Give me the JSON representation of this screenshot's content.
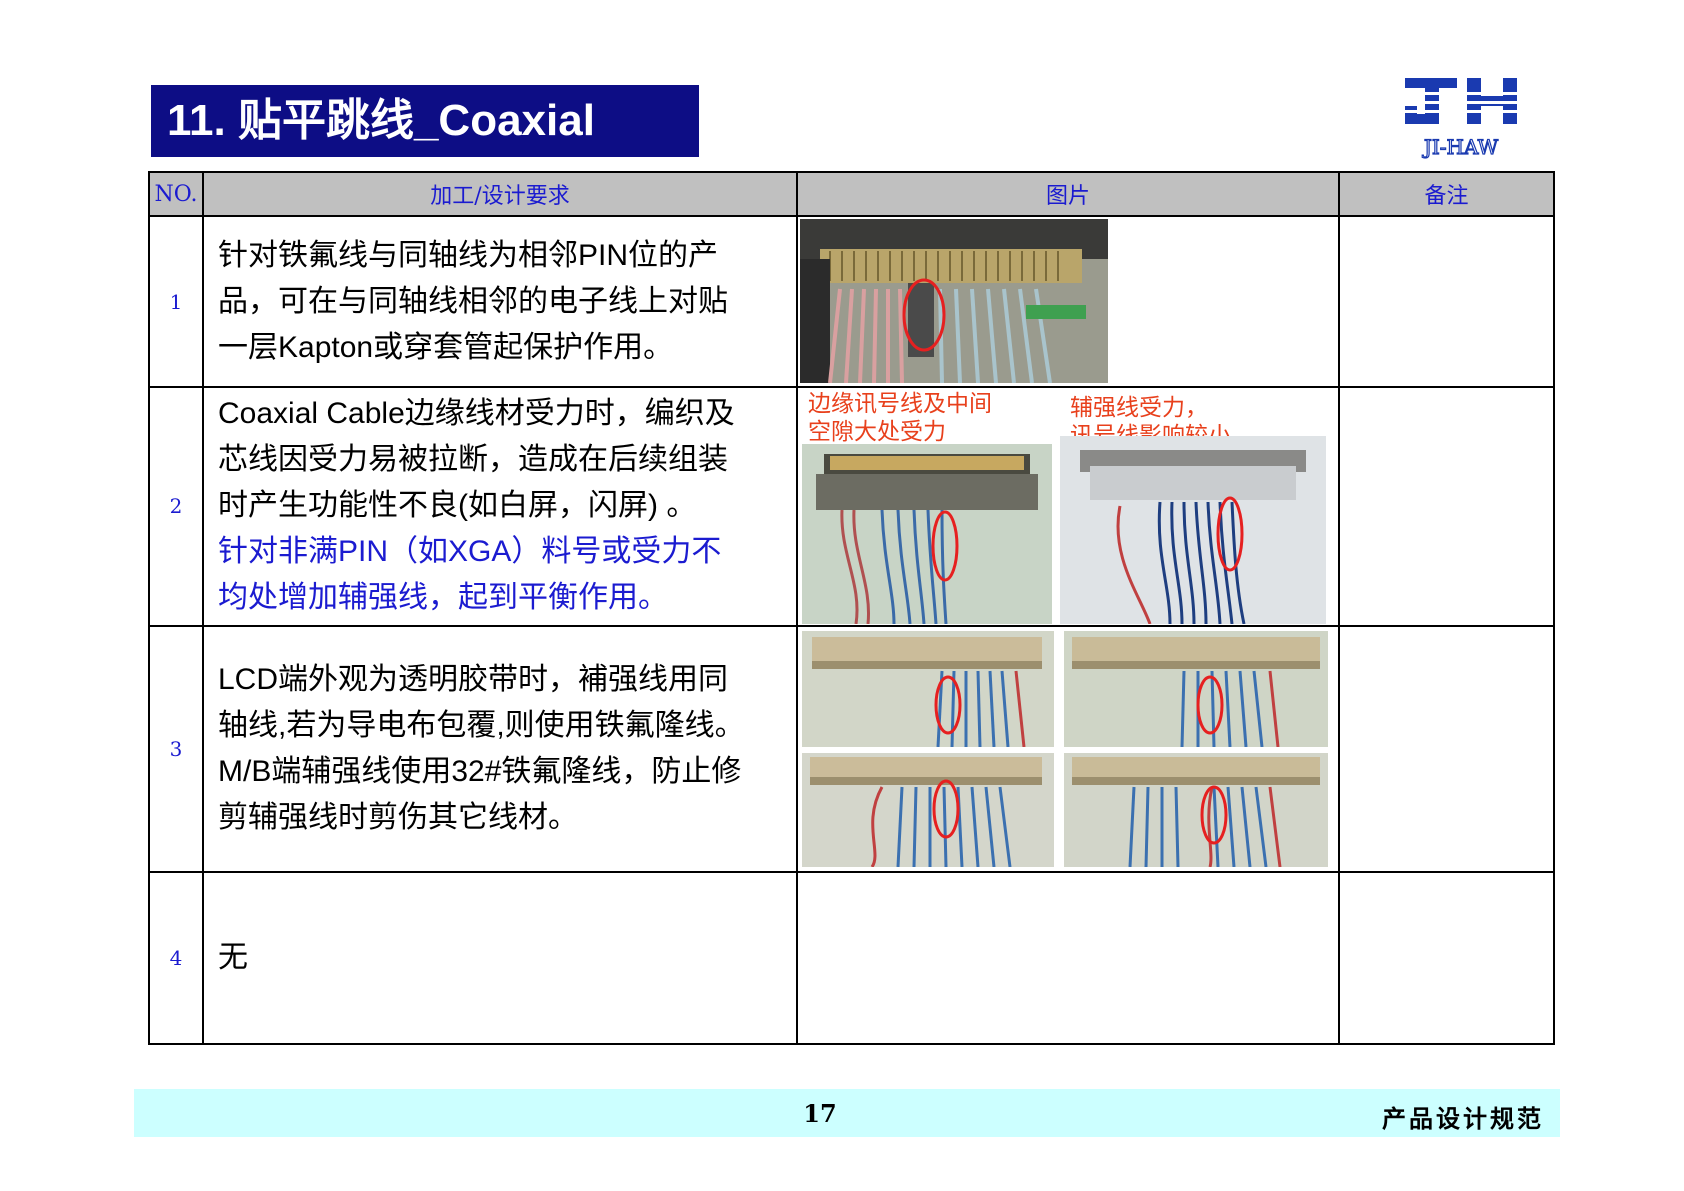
{
  "title": "11.  贴平跳线_Coaxial",
  "logo": {
    "text": "JI-HAW",
    "letters": "JH",
    "color": "#1a3ab0"
  },
  "table": {
    "headers": [
      "NO.",
      "加工/设计要求",
      "图片",
      "备注"
    ],
    "rows": [
      {
        "no": "1",
        "lines": [
          "针对铁氟线与同轴线为相邻PIN位的产",
          "品，可在与同轴线相邻的电子线上对贴",
          "一层Kapton或穿套管起保护作用。"
        ]
      },
      {
        "no": "2",
        "lines": [
          "Coaxial Cable边缘线材受力时，编织及",
          "芯线因受力易被拉断，造成在后续组装",
          "时产生功能性不良(如白屏，闪屏) 。"
        ],
        "blue_lines": [
          "针对非满PIN（如XGA）料号或受力不",
          "均处增加辅强线，起到平衡作用。"
        ],
        "annotations": {
          "left": [
            "边缘讯号线及中间",
            "空隙大处受力"
          ],
          "right": [
            "辅强线受力，",
            "讯号线影响较小"
          ]
        }
      },
      {
        "no": "3",
        "lines": [
          "LCD端外观为透明胶带时，補强线用同",
          "轴线,若为导电布包覆,则使用铁氟隆线。",
          "M/B端辅强线使用32#铁氟隆线，防止修",
          "剪辅强线时剪伤其它线材。"
        ]
      },
      {
        "no": "4",
        "lines": [
          "无"
        ]
      }
    ]
  },
  "footer": {
    "page": "17",
    "title": "产品设计规范"
  },
  "colors": {
    "title_bg": "#0d0d85",
    "header_bg": "#c0c0c0",
    "header_text": "#1b1bd0",
    "annotation": "#e8401c",
    "highlight": "#1b1bd0",
    "footer_bg": "#ccffff"
  }
}
